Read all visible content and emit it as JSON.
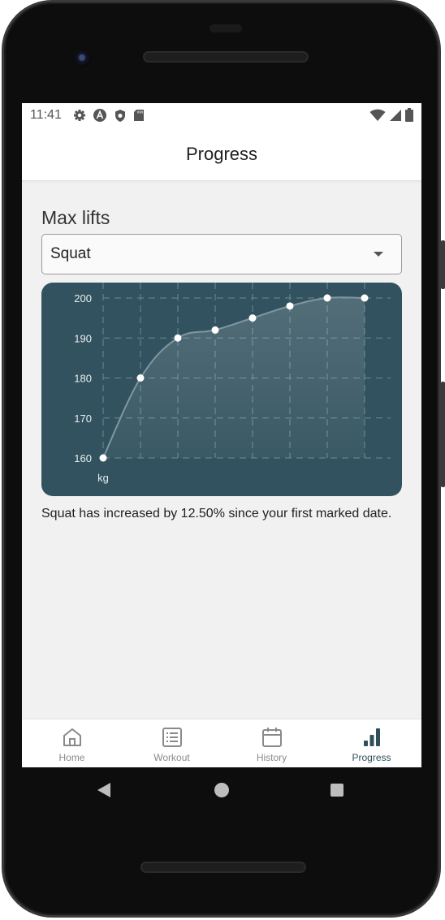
{
  "status_bar": {
    "time": "11:41",
    "left_icons": [
      "gear-icon",
      "app-a-icon",
      "shield-icon",
      "sd-card-icon"
    ],
    "right_icons": [
      "wifi-icon",
      "signal-icon",
      "battery-icon"
    ]
  },
  "app_bar": {
    "title": "Progress"
  },
  "section": {
    "title": "Max lifts"
  },
  "exercise_select": {
    "value": "Squat"
  },
  "chart_data": {
    "type": "line",
    "series": [
      {
        "values": [
          160,
          180,
          190,
          192,
          195,
          198,
          200,
          200
        ]
      }
    ],
    "ylim": [
      160,
      200
    ],
    "yticks": [
      200,
      190,
      180,
      170,
      160
    ],
    "ylabel": "kg",
    "grid": true,
    "curve": "smooth",
    "fill": true
  },
  "summary_text": "Squat has increased by 12.50% since your first marked date.",
  "bottom_nav": {
    "items": [
      {
        "label": "Home",
        "icon": "home-icon",
        "active": false
      },
      {
        "label": "Workout",
        "icon": "list-icon",
        "active": false
      },
      {
        "label": "History",
        "icon": "calendar-icon",
        "active": false
      },
      {
        "label": "Progress",
        "icon": "bar-chart-icon",
        "active": true
      }
    ]
  },
  "colors": {
    "chart_background": "#32525f",
    "accent": "#2f4f5a",
    "screen_background": "#f1f1f1"
  }
}
